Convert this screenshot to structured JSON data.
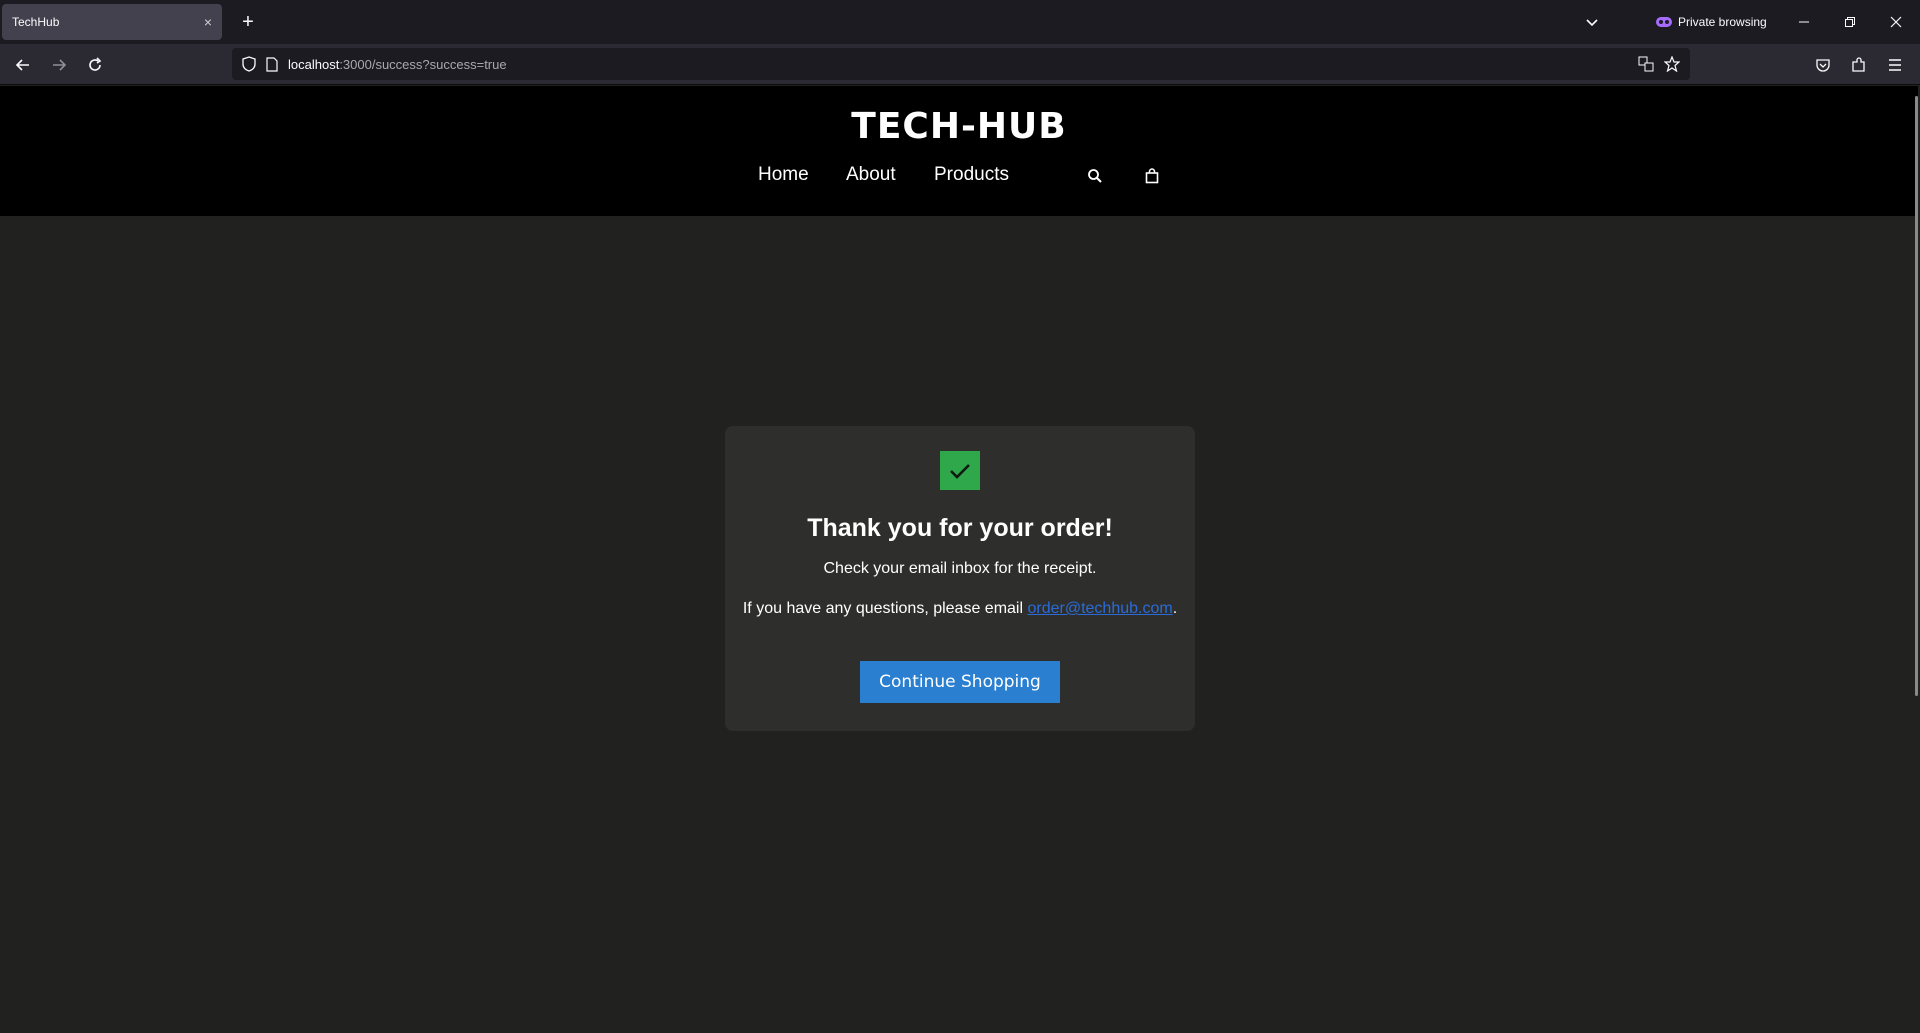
{
  "browser": {
    "tab_title": "TechHub",
    "tab_close": "×",
    "new_tab": "+",
    "private_label": "Private browsing",
    "url_host": "localhost",
    "url_path": ":3000/success?success=true"
  },
  "site": {
    "logo": "TECH-HUB",
    "nav": {
      "home": "Home",
      "about": "About",
      "products": "Products"
    }
  },
  "success": {
    "title": "Thank you for your order!",
    "receipt_text": "Check your email inbox for the receipt.",
    "contact_prefix": "If you have any questions, please email ",
    "contact_email": "order@techhub.com",
    "contact_suffix": ".",
    "button_label": "Continue Shopping"
  },
  "colors": {
    "check_bg": "#2ea84a",
    "button_bg": "#2a7fd0",
    "link": "#2a6bd8"
  }
}
